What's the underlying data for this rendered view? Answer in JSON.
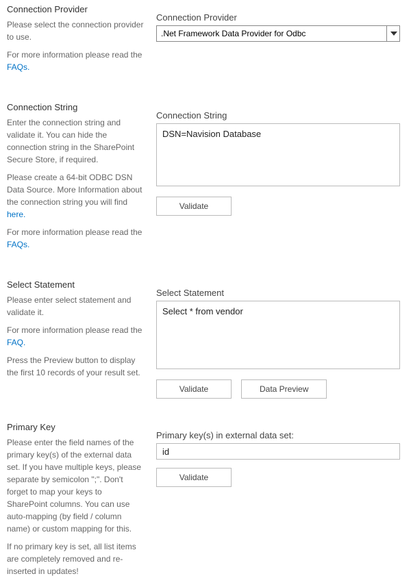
{
  "provider": {
    "heading": "Connection Provider",
    "desc": "Please select the connection provider to use.",
    "more_info_prefix": "For more information please read the ",
    "more_info_link": "FAQs.",
    "field_label": "Connection Provider",
    "selected": ".Net Framework Data Provider for Odbc"
  },
  "connstr": {
    "heading": "Connection String",
    "desc": "Enter the connection string and validate it. You can hide the connection string in the SharePoint Secure Store, if required.",
    "dsn_prefix": "Please create a 64-bit ODBC DSN Data Source. More Information about the connection string you will find ",
    "dsn_link": "here.",
    "more_info_prefix": "For more information please read the ",
    "more_info_link": "FAQs.",
    "field_label": "Connection String",
    "value": "DSN=Navision Database",
    "validate_label": "Validate"
  },
  "select": {
    "heading": "Select Statement",
    "desc": "Please enter select statement and validate it.",
    "more_info_prefix": "For more information please read the ",
    "more_info_link": "FAQ.",
    "preview_desc": "Press the Preview button to display the first 10 records of your result set.",
    "field_label": "Select Statement",
    "value": "Select * from vendor",
    "validate_label": "Validate",
    "preview_label": "Data Preview"
  },
  "pk": {
    "heading": "Primary Key",
    "desc1": "Please enter the field names of the primary key(s) of the external data set. If you have multiple keys, please separate by semicolon \";\". Don't forget to map your keys to SharePoint columns. You can use auto-mapping (by field / column name) or custom mapping for this.",
    "desc2": "If no primary key is set, all list items are completely removed and re-inserted in updates!",
    "field_label": "Primary key(s) in external data set:",
    "value": "id",
    "validate_label": "Validate"
  }
}
